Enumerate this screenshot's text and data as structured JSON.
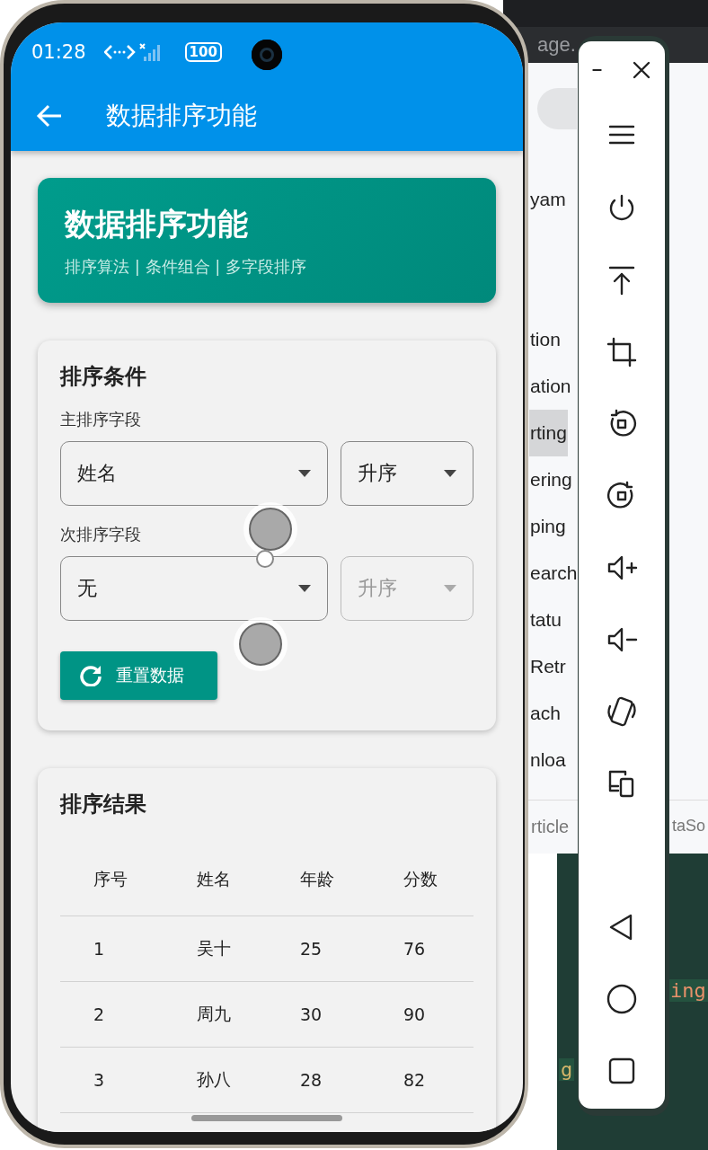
{
  "status_bar": {
    "time": "01:28",
    "battery": "100"
  },
  "app_bar": {
    "title": "数据排序功能"
  },
  "header": {
    "title": "数据排序功能",
    "subtitle": "排序算法 | 条件组合 | 多字段排序"
  },
  "sort_conditions": {
    "title": "排序条件",
    "fields": [
      {
        "label": "主排序字段",
        "field": {
          "value": "姓名",
          "disabled": false
        },
        "order": {
          "value": "升序",
          "disabled": false
        }
      },
      {
        "label": "次排序字段",
        "field": {
          "value": "无",
          "disabled": false
        },
        "order": {
          "value": "升序",
          "disabled": true
        }
      }
    ],
    "reset_button": "重置数据"
  },
  "results": {
    "title": "排序结果",
    "columns": [
      "序号",
      "姓名",
      "年龄",
      "分数"
    ],
    "rows": [
      [
        "1",
        "吴十",
        "25",
        "76"
      ],
      [
        "2",
        "周九",
        "30",
        "90"
      ],
      [
        "3",
        "孙八",
        "28",
        "82"
      ]
    ]
  },
  "background_ide": {
    "tab_title": "age.",
    "list_items": [
      {
        "text": "yam",
        "selected": false
      },
      {
        "text": "tion",
        "selected": false
      },
      {
        "text": "ation",
        "selected": false
      },
      {
        "text": "rting",
        "selected": true
      },
      {
        "text": "ering",
        "selected": false
      },
      {
        "text": "ping",
        "selected": false
      },
      {
        "text": "earch",
        "selected": false
      },
      {
        "text": "tatu",
        "selected": false
      },
      {
        "text": "Retr",
        "selected": false
      },
      {
        "text": "ach",
        "selected": false
      },
      {
        "text": "nloa",
        "selected": false
      }
    ],
    "bottom_tabs": [
      "rticle",
      "taSo"
    ],
    "code_fragments": [
      "ing",
      "g"
    ]
  }
}
